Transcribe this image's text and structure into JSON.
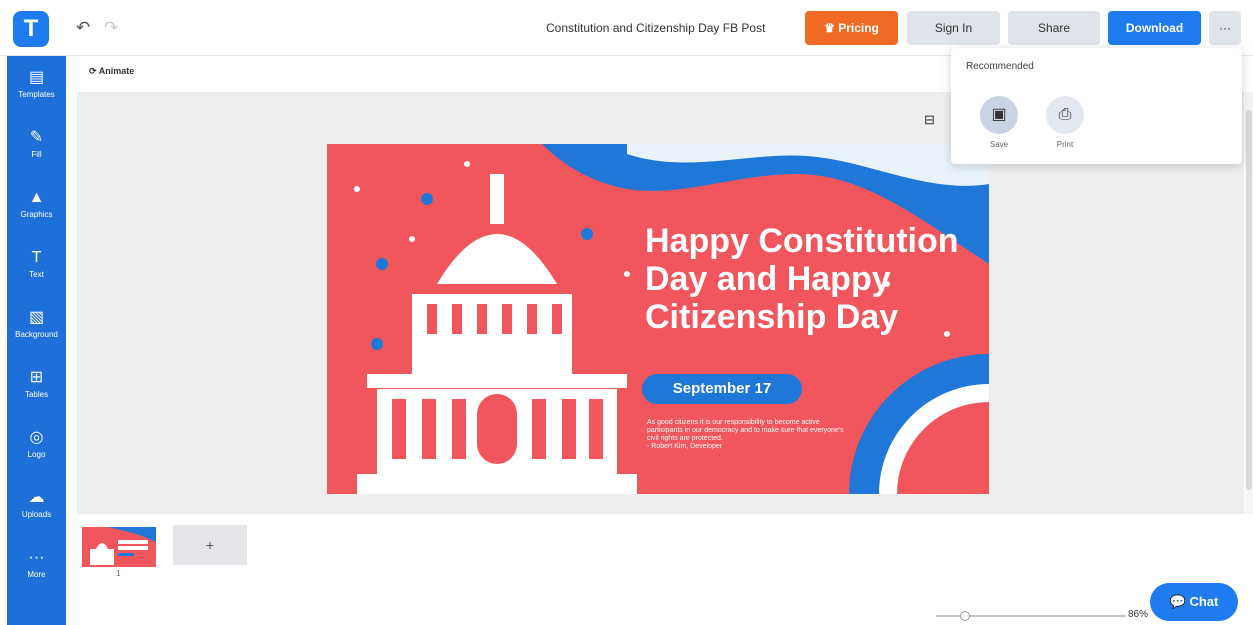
{
  "app": {
    "logo_letter": "T"
  },
  "toolbar": {
    "undo_icon": "↶",
    "redo_icon": "↷",
    "document_title": "Constitution and Citizenship Day FB Post",
    "pricing_label": "Pricing",
    "signin_label": "Sign In",
    "share_label": "Share",
    "download_label": "Download",
    "more_label": "···"
  },
  "sidebar": {
    "items": [
      {
        "label": "Templates",
        "icon": "▤",
        "icon_name": "templates-icon"
      },
      {
        "label": "Fill",
        "icon": "✎",
        "icon_name": "fill-icon"
      },
      {
        "label": "Graphics",
        "icon": "▲",
        "icon_name": "graphics-icon"
      },
      {
        "label": "Text",
        "icon": "T",
        "icon_name": "text-icon"
      },
      {
        "label": "Background",
        "icon": "▧",
        "icon_name": "background-icon"
      },
      {
        "label": "Tables",
        "icon": "⊞",
        "icon_name": "tables-icon"
      },
      {
        "label": "Logo",
        "icon": "◎",
        "icon_name": "logo-icon"
      },
      {
        "label": "Uploads",
        "icon": "☁",
        "icon_name": "uploads-icon"
      },
      {
        "label": "More",
        "icon": "···",
        "icon_name": "more-icon"
      }
    ]
  },
  "canvas_toolbar": {
    "animate_label": "Animate"
  },
  "design": {
    "headline": "Happy Constitution Day and Happy Citizenship Day",
    "date": "September 17",
    "body": "As good citizens it is our responsibility to become active participants in our democracy and to make sure that everyone's civil rights are protected.",
    "signature": "- Robert Kim, Developer"
  },
  "pages": {
    "current_page": "1",
    "add_label": "+"
  },
  "zoom": {
    "value": "86%",
    "level": 0.15
  },
  "chat": {
    "label": "Chat"
  },
  "dropdown": {
    "heading": "Recommended",
    "items": [
      {
        "label": "Save",
        "icon": "▣"
      },
      {
        "label": "Print",
        "icon": "⎙"
      }
    ]
  },
  "colors": {
    "brand_blue": "#1e7bf0",
    "sidebar_blue": "#1e6fd9",
    "pricing_orange": "#f06a23",
    "design_red": "#f0565b"
  }
}
